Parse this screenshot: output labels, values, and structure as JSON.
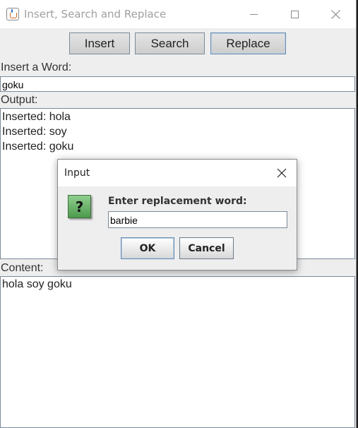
{
  "window": {
    "title": "Insert, Search and Replace"
  },
  "toolbar": {
    "insert_label": "Insert",
    "search_label": "Search",
    "replace_label": "Replace"
  },
  "form": {
    "insert_label": "Insert a Word:",
    "insert_value": "goku",
    "output_label": "Output:",
    "content_label": "Content:"
  },
  "output": {
    "lines": [
      "Inserted: hola",
      "Inserted: soy",
      "Inserted: goku"
    ]
  },
  "content": {
    "text": "hola soy goku"
  },
  "dialog": {
    "title": "Input",
    "icon": "question-icon",
    "icon_glyph": "?",
    "prompt": "Enter replacement word:",
    "value": "barbie",
    "ok_label": "OK",
    "cancel_label": "Cancel"
  },
  "colors": {
    "window_bg": "#eeeeee",
    "editor_bg": "#1e1e1e",
    "focus_border": "#6a8cb0",
    "question_icon": "#6cb56c"
  }
}
